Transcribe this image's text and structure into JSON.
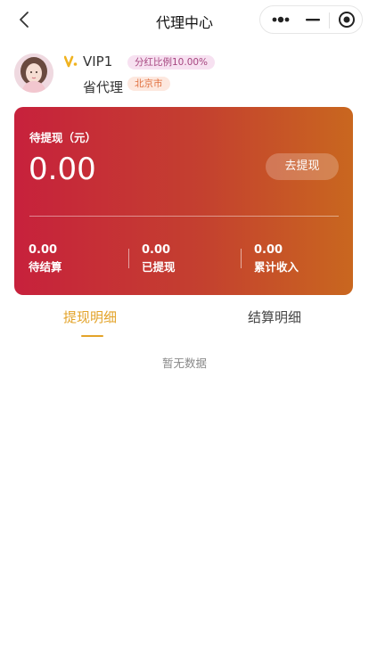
{
  "nav": {
    "title": "代理中心",
    "back_icon": "chevron-left-icon",
    "more_icon": "more-dots-icon",
    "minimize_icon": "minus-icon",
    "close_icon": "target-circle-icon"
  },
  "profile": {
    "avatar_icon": "avatar-photo",
    "vip_icon": "vip-v-icon",
    "vip_level": "VIP1",
    "ratio_badge": "分红比例10.00%",
    "role": "省代理",
    "city_badge": "北京市"
  },
  "card": {
    "label": "待提现（元）",
    "amount": "0.00",
    "withdraw_button": "去提现",
    "stats": [
      {
        "value": "0.00",
        "label": "待结算"
      },
      {
        "value": "0.00",
        "label": "已提现"
      },
      {
        "value": "0.00",
        "label": "累计收入"
      }
    ]
  },
  "tabs": [
    {
      "label": "提现明细",
      "active": true
    },
    {
      "label": "结算明细",
      "active": false
    }
  ],
  "empty_text": "暂无数据",
  "colors": {
    "accent": "#e3a329",
    "card_gradient_start": "#c7213c",
    "card_gradient_end": "#c9671f",
    "ratio_badge_bg": "#f7e1f1",
    "city_badge_bg": "#fde8df"
  }
}
